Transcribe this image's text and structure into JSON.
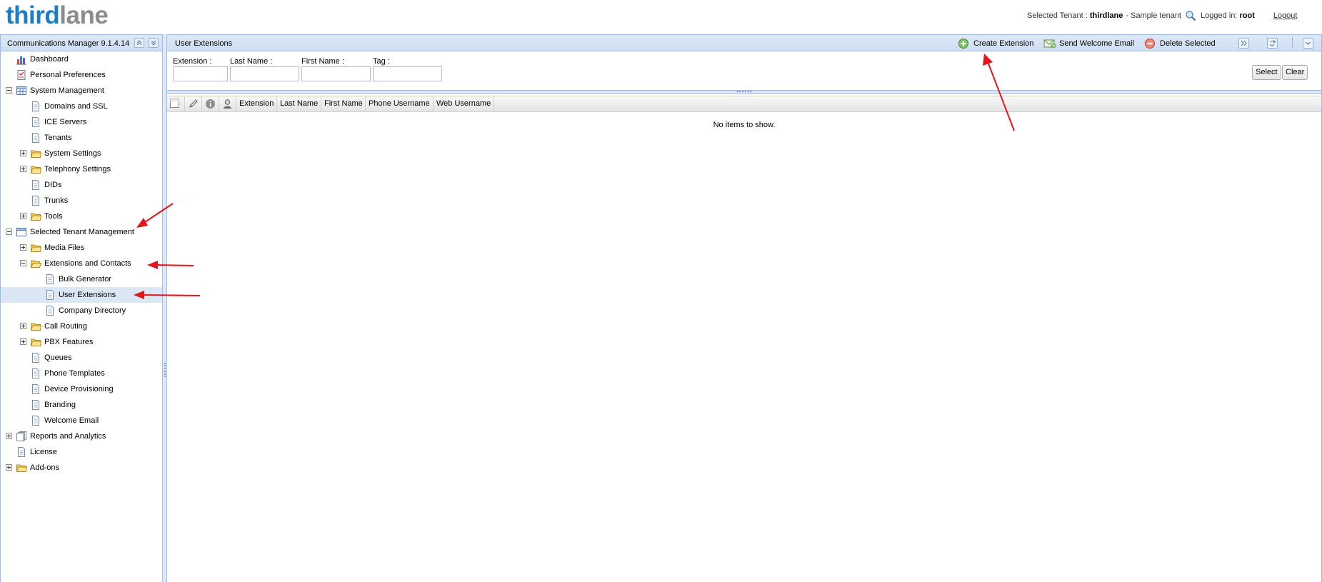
{
  "header": {
    "logo_part1": "third",
    "logo_part2": "lane",
    "tenant_label": "Selected Tenant :",
    "tenant_name": "thirdlane",
    "tenant_desc": "- Sample tenant",
    "logged_label": "Logged in:",
    "logged_user": "root",
    "logout": "Logout"
  },
  "sidebar": {
    "title": "Communications Manager 9.1.4.14",
    "items": [
      {
        "label": "Dashboard",
        "icon": "chart-icon",
        "expander": "none"
      },
      {
        "label": "Personal Preferences",
        "icon": "preferences-icon",
        "expander": "none"
      },
      {
        "label": "System Management",
        "icon": "grid-icon",
        "expander": "minus"
      },
      {
        "label": "Domains and SSL",
        "icon": "page-icon",
        "expander": "none"
      },
      {
        "label": "ICE Servers",
        "icon": "page-icon",
        "expander": "none"
      },
      {
        "label": "Tenants",
        "icon": "page-icon",
        "expander": "none"
      },
      {
        "label": "System Settings",
        "icon": "folder-icon",
        "expander": "plus"
      },
      {
        "label": "Telephony Settings",
        "icon": "folder-icon",
        "expander": "plus"
      },
      {
        "label": "DIDs",
        "icon": "page-icon",
        "expander": "none"
      },
      {
        "label": "Trunks",
        "icon": "page-icon",
        "expander": "none"
      },
      {
        "label": "Tools",
        "icon": "folder-icon",
        "expander": "plus"
      },
      {
        "label": "Selected Tenant Management",
        "icon": "window-icon",
        "expander": "minus"
      },
      {
        "label": "Media Files",
        "icon": "folder-icon",
        "expander": "plus"
      },
      {
        "label": "Extensions and Contacts",
        "icon": "folder-open-icon",
        "expander": "minus"
      },
      {
        "label": "Bulk Generator",
        "icon": "page-icon",
        "expander": "none"
      },
      {
        "label": "User Extensions",
        "icon": "page-icon",
        "expander": "none"
      },
      {
        "label": "Company Directory",
        "icon": "page-icon",
        "expander": "none"
      },
      {
        "label": "Call Routing",
        "icon": "folder-icon",
        "expander": "plus"
      },
      {
        "label": "PBX Features",
        "icon": "folder-icon",
        "expander": "plus"
      },
      {
        "label": "Queues",
        "icon": "page-icon",
        "expander": "none"
      },
      {
        "label": "Phone Templates",
        "icon": "page-icon",
        "expander": "none"
      },
      {
        "label": "Device Provisioning",
        "icon": "page-icon",
        "expander": "none"
      },
      {
        "label": "Branding",
        "icon": "page-icon",
        "expander": "none"
      },
      {
        "label": "Welcome Email",
        "icon": "page-icon",
        "expander": "none"
      },
      {
        "label": "Reports and Analytics",
        "icon": "pages-icon",
        "expander": "plus"
      },
      {
        "label": "License",
        "icon": "page-icon",
        "expander": "none"
      },
      {
        "label": "Add-ons",
        "icon": "folder-icon",
        "expander": "plus"
      }
    ],
    "selected": "User Extensions"
  },
  "main": {
    "title": "User Extensions",
    "toolbar": {
      "create": "Create Extension",
      "send_welcome": "Send Welcome Email",
      "delete": "Delete Selected"
    },
    "filter": {
      "extension_label": "Extension :",
      "last_name_label": "Last Name :",
      "first_name_label": "First Name :",
      "tag_label": "Tag :",
      "extension_value": "",
      "last_name_value": "",
      "first_name_value": "",
      "tag_value": "",
      "select_button": "Select",
      "clear_button": "Clear"
    },
    "grid": {
      "columns": [
        "Extension",
        "Last Name",
        "First Name",
        "Phone Username",
        "Web Username"
      ],
      "empty_text": "No items to show."
    }
  },
  "colors": {
    "accent": "#1c7dc4",
    "header_bg": "#dfe9f6",
    "panel_border": "#99bbe8",
    "selected_row": "#dce7f5",
    "annotation_arrow": "#e3151b"
  }
}
